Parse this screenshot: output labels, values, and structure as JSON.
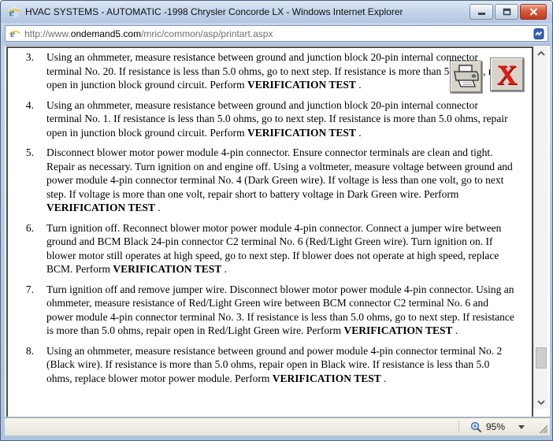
{
  "window": {
    "title": "HVAC SYSTEMS - AUTOMATIC -1998 Chrysler Concorde LX - Windows Internet Explorer",
    "controls": {
      "minimize": "minimize",
      "restore": "restore",
      "close": "close"
    }
  },
  "address_bar": {
    "url_prefix": "http://www.",
    "url_domain": "ondemand5.com",
    "url_path": "/mric/common/asp/printart.aspx",
    "refresh_icon": "refresh-icon",
    "favicon": "ie-favicon"
  },
  "overlay_buttons": {
    "print": "printer-icon",
    "close_article": "red-x-close-icon",
    "close_glyph": "X"
  },
  "content": {
    "steps": [
      {
        "num": "3.",
        "pre": "Using an ohmmeter, measure resistance between ground and junction block 20-pin internal connector terminal No. 20. If resistance is less than 5.0 ohms, go to next step. If resistance is more than 5.0 ohms, repair open in junction block ground circuit. Perform ",
        "bold": "VERIFICATION TEST",
        "post": " ."
      },
      {
        "num": "4.",
        "pre": "Using an ohmmeter, measure resistance between ground and junction block 20-pin internal connector terminal No. 1. If resistance is less than 5.0 ohms, go to next step. If resistance is more than 5.0 ohms, repair open in junction block ground circuit. Perform ",
        "bold": "VERIFICATION TEST",
        "post": " ."
      },
      {
        "num": "5.",
        "pre": "Disconnect blower motor power module 4-pin connector. Ensure connector terminals are clean and tight. Repair as necessary. Turn ignition on and engine off. Using a voltmeter, measure voltage between ground and power module 4-pin connector terminal No. 4 (Dark Green wire). If voltage is less than one volt, go to next step. If voltage is more than one volt, repair short to battery voltage in Dark Green wire. Perform ",
        "bold": "VERIFICATION TEST",
        "post": " ."
      },
      {
        "num": "6.",
        "pre": "Turn ignition off. Reconnect blower motor power module 4-pin connector. Connect a jumper wire between ground and BCM Black 24-pin connector C2 terminal No. 6 (Red/Light Green wire). Turn ignition on. If blower motor still operates at high speed, go to next step. If blower does not operate at high speed, replace BCM. Perform ",
        "bold": "VERIFICATION TEST",
        "post": " ."
      },
      {
        "num": "7.",
        "pre": "Turn ignition off and remove jumper wire. Disconnect blower motor power module 4-pin connector. Using an ohmmeter, measure resistance of Red/Light Green wire between BCM connector C2 terminal No. 6 and power module 4-pin connector terminal No. 3. If resistance is less than 5.0 ohms, go to next step. If resistance is more than 5.0 ohms, repair open in Red/Light Green wire. Perform ",
        "bold": "VERIFICATION TEST",
        "post": " ."
      },
      {
        "num": "8.",
        "pre": "Using an ohmmeter, measure resistance between ground and power module 4-pin connector terminal No. 2 (Black wire). If resistance is more than 5.0 ohms, repair open in Black wire. If resistance is less than 5.0 ohms, replace blower motor power module. Perform ",
        "bold": "VERIFICATION TEST",
        "post": " ."
      }
    ]
  },
  "status_bar": {
    "zoom_level": "95%",
    "zoom_icon": "magnifier-icon"
  },
  "colors": {
    "frame_blue": "#b5c9e2",
    "close_button_red": "#c03a21",
    "red_x": "#e31b12",
    "domain_text": "#000000",
    "url_text": "#6f6f6f"
  }
}
